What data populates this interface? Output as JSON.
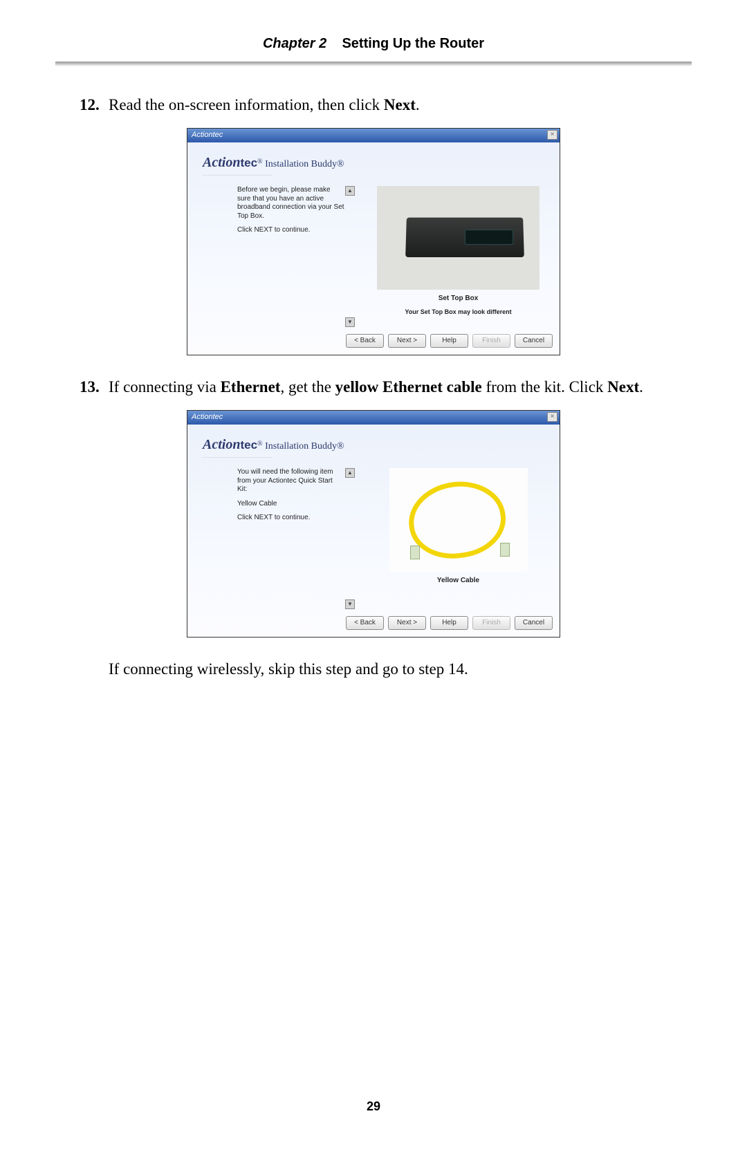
{
  "header": {
    "chapter_label": "Chapter 2",
    "chapter_title": "Setting Up the Router"
  },
  "steps": {
    "s12": {
      "num": "12.",
      "text_a": "Read the on-screen information, then click ",
      "text_b": "Next",
      "text_c": "."
    },
    "s13": {
      "num": "13.",
      "text_a": "If connecting via ",
      "text_b": "Ethernet",
      "text_c": ", get the ",
      "text_d": "yellow Ethernet cable",
      "text_e": " from the kit. Click ",
      "text_f": "Next",
      "text_g": "."
    },
    "note_after": "If connecting wirelessly, skip this step and go to step 14."
  },
  "page_number": "29",
  "dialog_common": {
    "titlebar": "Actiontec",
    "close": "×",
    "brand_script": "Action",
    "brand_tec": "tec",
    "brand_reg": "®",
    "brand_ib": " Installation Buddy®",
    "btn_back": "< Back",
    "btn_next": "Next >",
    "btn_help": "Help",
    "btn_finish": "Finish",
    "btn_cancel": "Cancel",
    "arrow_up": "▲",
    "arrow_down": "▼"
  },
  "dialog1": {
    "left_p1": "Before we begin, please make sure that you have an active broadband connection via your Set Top Box.",
    "left_p2": "Click NEXT to continue.",
    "caption": "Set Top Box",
    "note": "Your Set Top Box may look different"
  },
  "dialog2": {
    "left_p1": "You will need the following item from your Actiontec Quick Start Kit:",
    "left_p2": "Yellow Cable",
    "left_p3": "Click NEXT to continue.",
    "caption": "Yellow Cable"
  }
}
